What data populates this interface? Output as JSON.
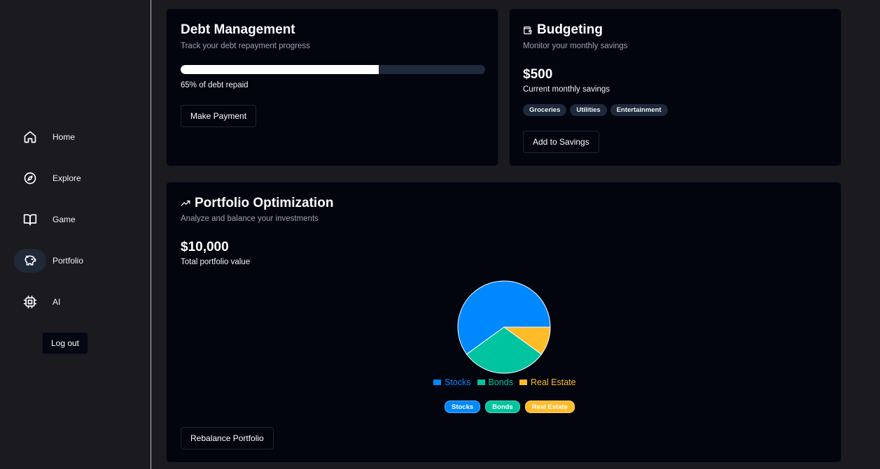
{
  "sidebar": {
    "items": [
      {
        "label": "Home",
        "icon": "home-icon"
      },
      {
        "label": "Explore",
        "icon": "compass-icon"
      },
      {
        "label": "Game",
        "icon": "book-icon"
      },
      {
        "label": "Portfolio",
        "icon": "piggy-bank-icon",
        "active": true
      },
      {
        "label": "AI",
        "icon": "cpu-icon"
      }
    ],
    "logout_label": "Log out"
  },
  "debt": {
    "title": "Debt Management",
    "subtitle": "Track your debt repayment progress",
    "progress_percent": 65,
    "progress_label": "65% of debt repaid",
    "button_label": "Make Payment"
  },
  "budget": {
    "title": "Budgeting",
    "title_icon": "wallet-icon",
    "subtitle": "Monitor your monthly savings",
    "value": "$500",
    "value_label": "Current monthly savings",
    "tags": [
      "Groceries",
      "Utilities",
      "Entertainment"
    ],
    "button_label": "Add to Savings"
  },
  "portfolio": {
    "title": "Portfolio Optimization",
    "title_icon": "trending-up-icon",
    "subtitle": "Analyze and balance your investments",
    "value": "$10,000",
    "value_label": "Total portfolio value",
    "button_label": "Rebalance Portfolio"
  },
  "chart_data": {
    "type": "pie",
    "categories": [
      "Stocks",
      "Bonds",
      "Real Estate"
    ],
    "values": [
      60,
      30,
      10
    ],
    "colors": [
      "#0088fe",
      "#00c49f",
      "#ffbb28"
    ],
    "legend_position": "bottom"
  },
  "colors": {
    "background": "#1b1b1f",
    "card": "#02040e",
    "accent_blue": "#0088fe",
    "accent_green": "#00c49f",
    "accent_yellow": "#ffbb28"
  }
}
